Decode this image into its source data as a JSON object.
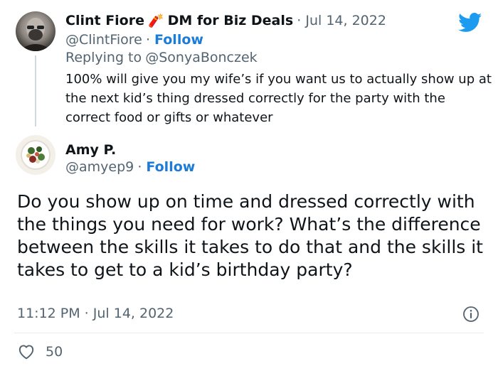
{
  "tweet1": {
    "name": "Clint Fiore",
    "name_emoji": "🧨",
    "name_suffix": "DM for Biz Deals",
    "date": "Jul 14, 2022",
    "handle": "@ClintFiore",
    "follow": "Follow",
    "replying_label": "Replying to",
    "replying_to": "@SonyaBonczek",
    "text": "100% will give you my wife’s if you want us to actually show up at the next kid’s thing dressed correctly for the party with the correct food or gifts or whatever"
  },
  "tweet2": {
    "name": "Amy P.",
    "handle": "@amyep9",
    "follow": "Follow",
    "text": "Do you show up on time and dressed correctly with the things you need for work? What’s the difference between the skills it takes to do that and the skills it takes to get to a kid’s birthday party?",
    "timestamp": "11:12 PM · Jul 14, 2022",
    "likes": "50"
  },
  "colors": {
    "twitter_blue": "#1d9bf0",
    "link_blue": "#1d7bd9",
    "muted": "#536471",
    "text": "#0f1419"
  },
  "icons": [
    "twitter-bird-icon",
    "info-icon",
    "heart-icon"
  ]
}
